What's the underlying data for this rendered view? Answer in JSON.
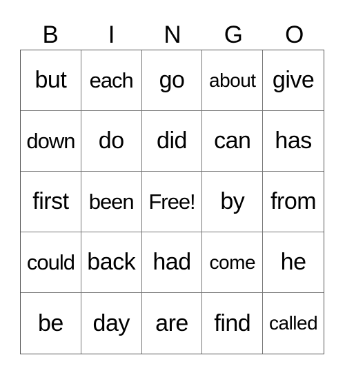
{
  "header": {
    "letters": [
      "B",
      "I",
      "N",
      "G",
      "O"
    ]
  },
  "grid": {
    "rows": [
      [
        "but",
        "each",
        "go",
        "about",
        "give"
      ],
      [
        "down",
        "do",
        "did",
        "can",
        "has"
      ],
      [
        "first",
        "been",
        "Free!",
        "by",
        "from"
      ],
      [
        "could",
        "back",
        "had",
        "come",
        "he"
      ],
      [
        "be",
        "day",
        "are",
        "find",
        "called"
      ]
    ],
    "free_space": "Free!"
  }
}
